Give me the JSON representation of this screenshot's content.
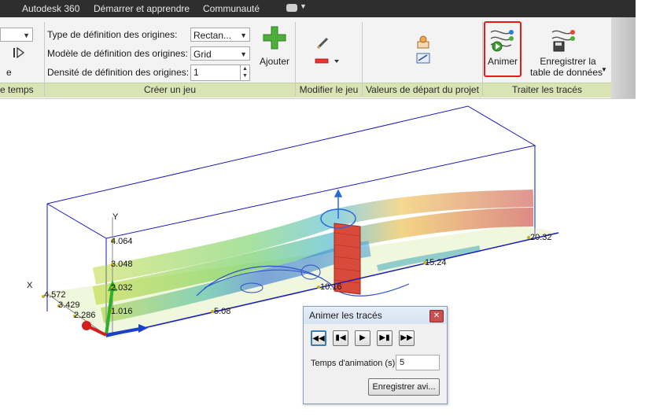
{
  "menubar": {
    "items": [
      "Autodesk 360",
      "Démarrer et apprendre",
      "Communauté"
    ]
  },
  "ribbon": {
    "left_clip": {
      "label_partial": "e",
      "panel_partial": "e temps"
    },
    "creer_jeu": {
      "panel_title": "Créer un jeu",
      "type_label": "Type de définition des origines:",
      "type_value": "Rectan...",
      "modele_label": "Modèle de définition des origines:",
      "modele_value": "Grid",
      "densite_label": "Densité de définition des origines:",
      "densite_value": "1",
      "ajouter_label": "Ajouter"
    },
    "modifier_jeu": {
      "panel_title": "Modifier le jeu"
    },
    "valeurs_depart": {
      "panel_title": "Valeurs de départ du projet"
    },
    "traiter": {
      "panel_title": "Traiter les tracés",
      "animer_label": "Animer",
      "enregistrer_line1": "Enregistrer la",
      "enregistrer_line2": "table de données"
    }
  },
  "viewport": {
    "axis_labels": {
      "y_axis": "Y",
      "x_axis": "X",
      "y_ticks": [
        "4.064",
        "3.048",
        "2.032",
        "1.016"
      ],
      "x_ticks": [
        "4.572",
        "3.429",
        "2.286"
      ],
      "z_ticks": [
        "5.08",
        "10.16",
        "15.24",
        "20.32"
      ]
    }
  },
  "dialog": {
    "title": "Animer les tracés",
    "close_glyph": "✕",
    "time_label": "Temps d'animation (s)",
    "time_value": "5",
    "save_label": "Enregistrer avi..."
  },
  "colors": {
    "menubar_bg": "#2e2e2e",
    "panel_bar": "#d9e3b3",
    "highlight": "#e31b1b",
    "bbox": "#1a1ab8"
  }
}
